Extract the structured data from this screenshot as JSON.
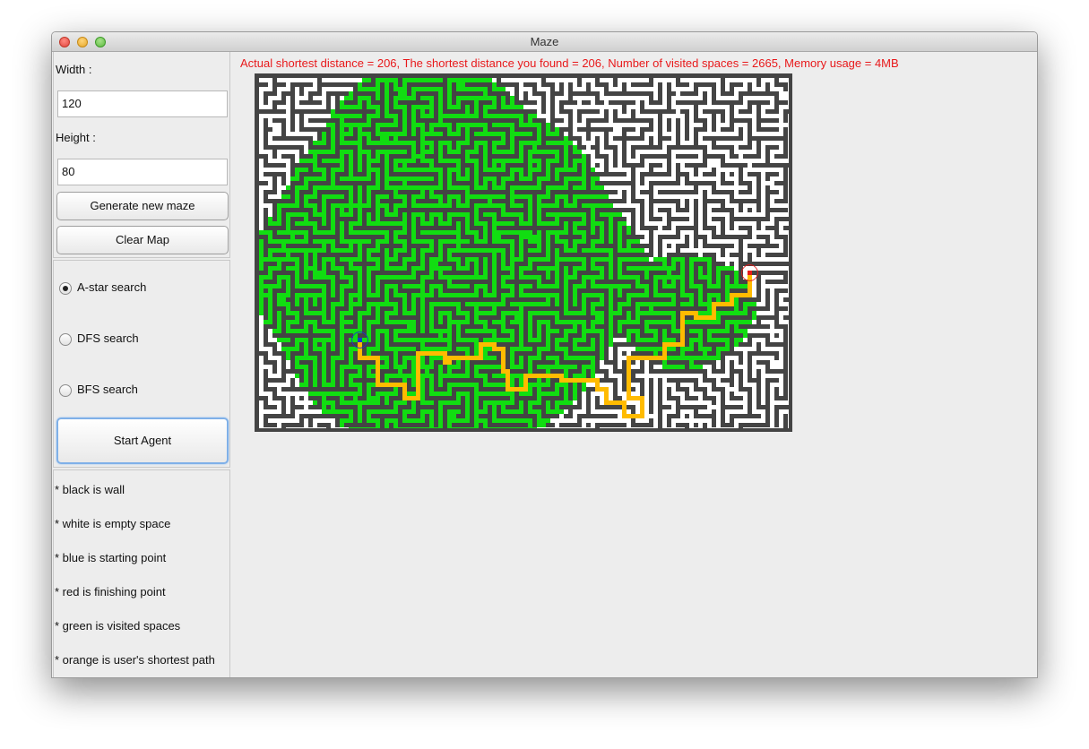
{
  "window": {
    "title": "Maze"
  },
  "settings": {
    "width_label": "Width :",
    "width_value": "120",
    "height_label": "Height :",
    "height_value": "80",
    "generate_button": "Generate new maze",
    "clear_button": "Clear Map"
  },
  "search": {
    "options": [
      {
        "label": "A-star search",
        "selected": true
      },
      {
        "label": "DFS search",
        "selected": false
      },
      {
        "label": "BFS search",
        "selected": false
      }
    ],
    "start_button": "Start Agent"
  },
  "legend": [
    "* black is wall",
    "* white is empty space",
    "* blue is starting point",
    "* red is finishing point",
    "* green is visited spaces",
    "* orange is user's shortest path"
  ],
  "status": {
    "text": "Actual shortest distance = 206, The shortest distance you found = 206, Number of visited spaces  = 2665, Memory usage = 4MB",
    "color": "#e8191b"
  },
  "maze": {
    "grid_width": 120,
    "grid_height": 80,
    "colors": {
      "wall": "#444444",
      "empty": "#ffffff",
      "visited": "#11dd11",
      "path": "#ffbb00",
      "start": "#1c2fd0",
      "finish": "#e81b1b"
    }
  }
}
